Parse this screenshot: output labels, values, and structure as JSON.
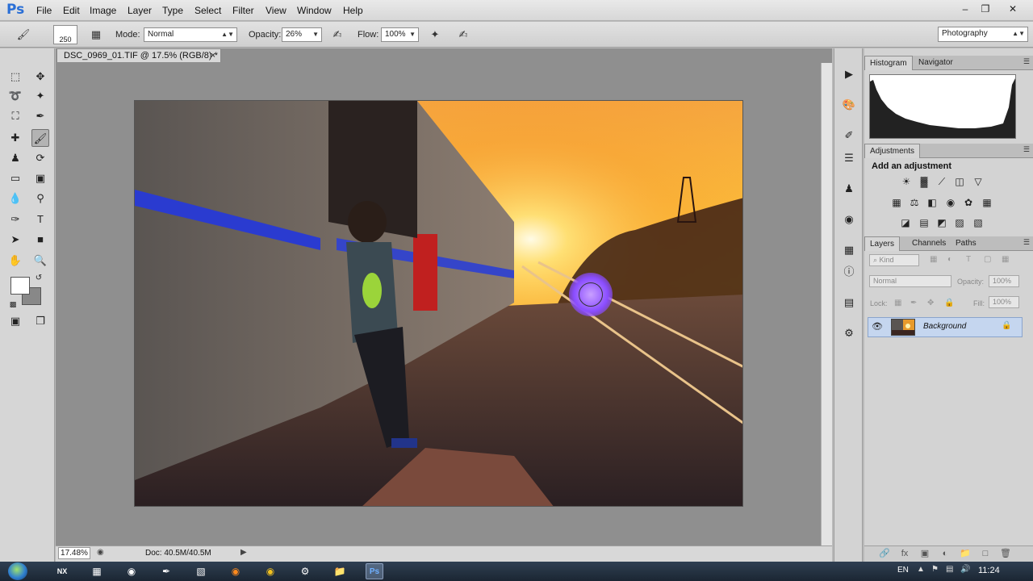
{
  "app": {
    "logo": "Ps",
    "menu": [
      "File",
      "Edit",
      "Image",
      "Layer",
      "Type",
      "Select",
      "Filter",
      "View",
      "Window",
      "Help"
    ],
    "window_controls": [
      "minimize",
      "restore",
      "close"
    ]
  },
  "options_bar": {
    "brush_size": "250",
    "mode_label": "Mode:",
    "mode_value": "Normal",
    "opacity_label": "Opacity:",
    "opacity_value": "26%",
    "flow_label": "Flow:",
    "flow_value": "100%",
    "workspace": "Photography"
  },
  "document": {
    "tab_title": "DSC_0969_01.TIF @ 17.5% (RGB/8) *",
    "zoom": "17.48%",
    "doc_size": "Doc: 40.5M/40.5M"
  },
  "panels": {
    "histogram_tabs": [
      "Histogram",
      "Navigator"
    ],
    "adjustments_tab": "Adjustments",
    "adjustments_title": "Add an adjustment",
    "layers_tabs": [
      "Layers",
      "Channels",
      "Paths"
    ],
    "kind_filter": "Kind",
    "blend_mode": "Normal",
    "opacity_label": "Opacity:",
    "opacity_value": "100%",
    "lock_label": "Lock:",
    "fill_label": "Fill:",
    "fill_value": "100%",
    "layer_name": "Background"
  },
  "taskbar": {
    "language": "EN",
    "time": "11:24"
  },
  "colors": {
    "accent": "#2a6fd6",
    "foreground_swatch": "#ffffff",
    "background_swatch": "#888888",
    "brush_cursor": "#8a4dff"
  }
}
